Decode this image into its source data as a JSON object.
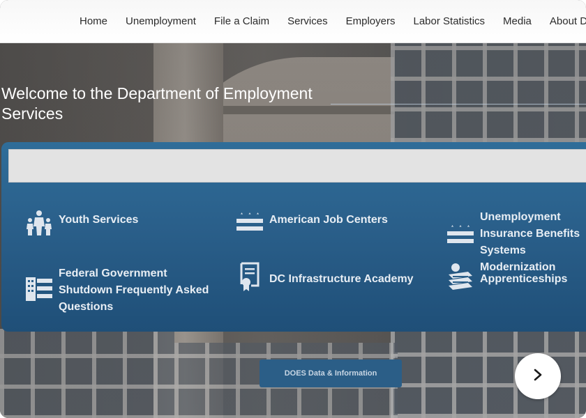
{
  "nav": {
    "items": [
      {
        "label": "Home"
      },
      {
        "label": "Unemployment"
      },
      {
        "label": "File a Claim"
      },
      {
        "label": "Services"
      },
      {
        "label": "Employers"
      },
      {
        "label": "Labor Statistics"
      },
      {
        "label": "Media"
      },
      {
        "label": "About DOES"
      }
    ]
  },
  "hero": {
    "title": "Welcome to the Department of Employment Services"
  },
  "search": {
    "placeholder": ""
  },
  "quick_links": [
    {
      "label": "Youth Services",
      "icon": "family-icon"
    },
    {
      "label": "American Job Centers",
      "icon": "dc-flag-icon"
    },
    {
      "label": "Unemployment Insurance Benefits Systems Modernization",
      "icon": "dc-flag-icon"
    },
    {
      "label": "Federal Government Shutdown Frequently Asked Questions",
      "icon": "building-flag-icon"
    },
    {
      "label": "DC Infrastructure Academy",
      "icon": "certificate-icon"
    },
    {
      "label": "Apprenticeships",
      "icon": "books-apple-icon"
    }
  ],
  "data_button": {
    "label": "DOES Data & Information"
  },
  "next_button": {
    "icon": "chevron-right-icon"
  },
  "colors": {
    "panel_blue": "#2a5f8a",
    "icon_light": "#dfe6ee",
    "nav_text": "#2b2b2b"
  }
}
